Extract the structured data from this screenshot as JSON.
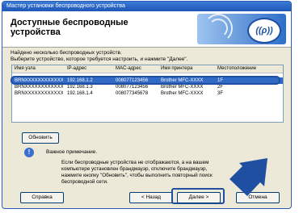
{
  "window": {
    "title": "Мастер установки беспроводного устройства"
  },
  "banner": {
    "title": "Доступные беспроводные устройства"
  },
  "instructions": {
    "line1": "Найдено несколько беспроводных устройств.",
    "line2": "Выберите устройство, которое требуется настроить, и нажмите \"Далее\"."
  },
  "table": {
    "columns": [
      "Имя узла",
      "IP-адрес",
      "MAC-адрес",
      "Имя принтера",
      "Местоположение"
    ],
    "rows": [
      [
        "BRNXXXXXXXXXXXXX",
        "192.168.1.2",
        "008077123456",
        "Brother MFC-XXXX",
        "1F"
      ],
      [
        "BRNXXXXXXXXXXXXX",
        "192.168.1.3",
        "008077123456",
        "Brother MFC-XXXX",
        "2F"
      ],
      [
        "BRNXXXXXXXXXXXXX",
        "192.168.1.4",
        "008077345678",
        "Brother MFC-XXXX",
        "3F"
      ]
    ]
  },
  "refresh_label": "Обновить",
  "note": {
    "heading": "Важное примечание.",
    "line1": "Если беспроводные устройства не отображаются, а на вашем",
    "line2": "компьютере установлен брандмауэр, отключите брандмауэр,",
    "line3": "нажмите кнопку \"Обновить\", чтобы выполнить повторный поиск",
    "line4": "беспроводной сети."
  },
  "buttons": {
    "help": "Справка",
    "back": "< Назад",
    "next": "Далее >",
    "cancel": "Отмена"
  },
  "colors": {
    "accent": "#1f4fa0",
    "selection": "#316ac5"
  }
}
